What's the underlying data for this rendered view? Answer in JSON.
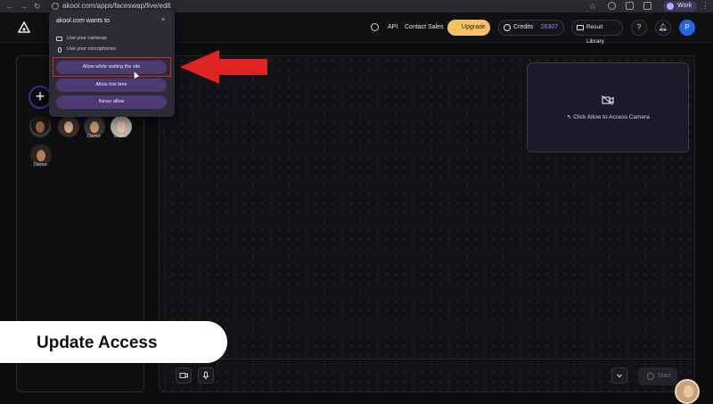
{
  "browser": {
    "url": "akool.com/apps/faceswap/live/edit",
    "profile_label": "Work"
  },
  "header": {
    "api_label": "API",
    "contact_label": "Contact Sales",
    "upgrade_label": "Upgrade",
    "credits_label": "Credits",
    "credits_value": "28307",
    "result_library_label": "Result Library",
    "help_glyph": "?",
    "user_initial": "P"
  },
  "faces": {
    "add_glyph": "+",
    "demo_label": "Demo"
  },
  "permission_popup": {
    "title": "akool.com wants to",
    "close_glyph": "×",
    "permissions": [
      "Use your cameras",
      "Use your microphones"
    ],
    "buttons": [
      "Allow while visiting the site",
      "Allow this time",
      "Never allow"
    ]
  },
  "stage": {
    "camera_hint": "Click Allow to Access Camera",
    "start_label": "Start"
  },
  "caption": "Update Access",
  "colors": {
    "accent_purple": "#4c3b73",
    "upgrade_yellow": "#f5c26b",
    "credits_value": "#9b8cff",
    "annotation_red": "#e02323"
  }
}
